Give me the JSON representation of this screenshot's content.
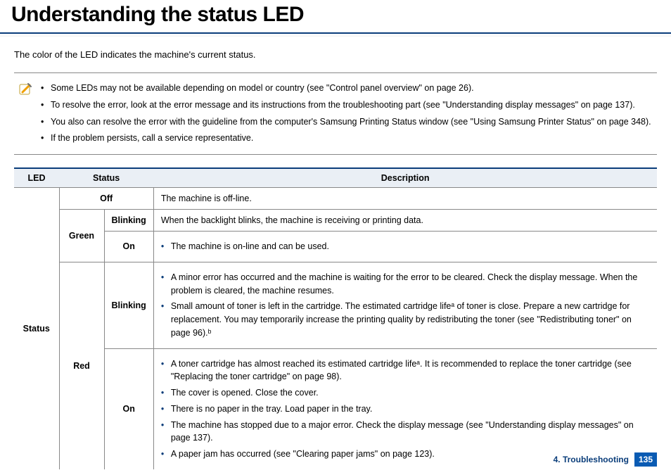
{
  "header": {
    "title": "Understanding the status LED"
  },
  "intro": "The color of the LED indicates the machine's current status.",
  "notes": {
    "items": [
      "Some LEDs may not be available depending on model or country (see \"Control panel overview\" on page 26).",
      "To resolve the error, look at the error message and its instructions from the troubleshooting part (see \"Understanding display messages\" on page 137).",
      "You also can resolve the error with the guideline from the computer's Samsung Printing Status window (see \"Using Samsung Printer Status\" on page 348).",
      "If the problem persists, call a service representative."
    ]
  },
  "table": {
    "headers": {
      "led": "LED",
      "status": "Status",
      "description": "Description"
    },
    "led_label": "Status",
    "rows": {
      "off": {
        "status": "Off",
        "desc": "The machine is off-line."
      },
      "green": {
        "color": "Green",
        "blinking": {
          "label": "Blinking",
          "desc": "When the backlight blinks, the machine is receiving or printing data."
        },
        "on": {
          "label": "On",
          "desc": "The machine is on-line and can be used."
        }
      },
      "red": {
        "color": "Red",
        "blinking": {
          "label": "Blinking",
          "items": [
            "A minor error has occurred and the machine is waiting for the error to be cleared. Check the display message. When the problem is cleared, the machine resumes.",
            "Small amount of toner is left in the cartridge. The estimated cartridge lifeᵃ of toner is close. Prepare a new cartridge for replacement. You may temporarily increase the printing quality by redistributing the toner (see \"Redistributing toner\" on page 96).ᵇ"
          ]
        },
        "on": {
          "label": "On",
          "items": [
            "A toner cartridge has almost reached its estimated cartridge lifeᵃ. It is recommended to replace the toner cartridge (see \"Replacing the toner cartridge\" on page 98).",
            "The cover is opened. Close the cover.",
            "There is no paper in the tray. Load paper in the tray.",
            "The machine has stopped due to a major error. Check the display message (see \"Understanding display messages\" on page 137).",
            "A paper jam has occurred (see \"Clearing paper jams\" on page 123)."
          ]
        }
      }
    }
  },
  "footer": {
    "chapter": "4. Troubleshooting",
    "page": "135"
  }
}
